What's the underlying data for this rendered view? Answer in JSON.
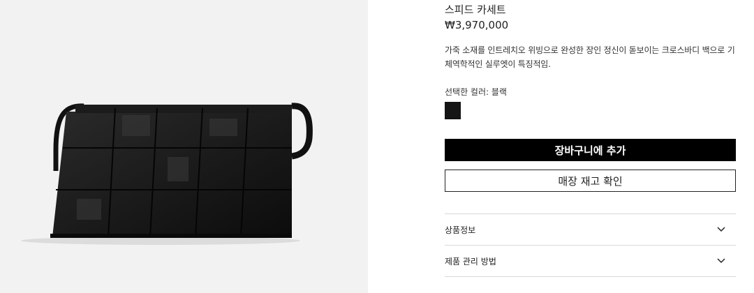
{
  "product": {
    "title": "스피드 카세트",
    "price": "₩3,970,000",
    "description": "가죽 소재를 인트레치오 위빙으로 완성한 장인 정신이 돋보이는 크로스바디 백으로 기체역학적인 실루엣이 특징적임.",
    "selected_color_label": "선택한 컬러: 블랙",
    "swatch_color": "#151515"
  },
  "actions": {
    "add_to_cart": "장바구니에 추가",
    "check_store_stock": "매장 재고 확인"
  },
  "accordion": [
    {
      "label": "상품정보",
      "icon": "chevron-down-icon"
    },
    {
      "label": "제품 관리 방법",
      "icon": "chevron-down-icon"
    }
  ]
}
